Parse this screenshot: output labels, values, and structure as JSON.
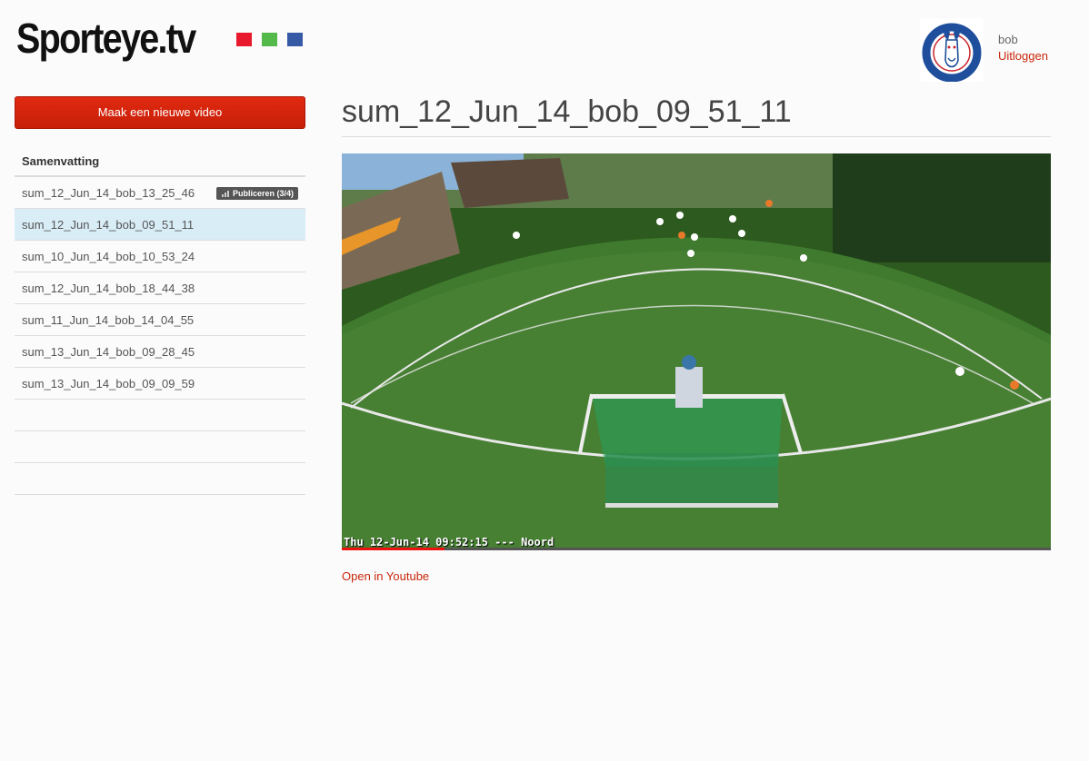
{
  "brand": {
    "name": "Sporteye.tv",
    "colors": [
      "#e8192c",
      "#52b94a",
      "#3659a5"
    ]
  },
  "user": {
    "name": "bob",
    "logout_label": "Uitloggen",
    "club_logo": "club-goat-logo"
  },
  "sidebar": {
    "new_video_label": "Maak een nieuwe video",
    "list_header": "Samenvatting",
    "items": [
      {
        "label": "sum_12_Jun_14_bob_13_25_46",
        "badge": "Publiceren (3/4)"
      },
      {
        "label": "sum_12_Jun_14_bob_09_51_11",
        "active": true
      },
      {
        "label": "sum_10_Jun_14_bob_10_53_24"
      },
      {
        "label": "sum_12_Jun_14_bob_18_44_38"
      },
      {
        "label": "sum_11_Jun_14_bob_14_04_55"
      },
      {
        "label": "sum_13_Jun_14_bob_09_28_45"
      },
      {
        "label": "sum_13_Jun_14_bob_09_09_59"
      }
    ]
  },
  "main": {
    "title": "sum_12_Jun_14_bob_09_51_11",
    "video_overlay": "Thu 12-Jun-14 09:52:15 --- Noord",
    "progress": 0.145,
    "youtube_label": "Open in Youtube"
  }
}
